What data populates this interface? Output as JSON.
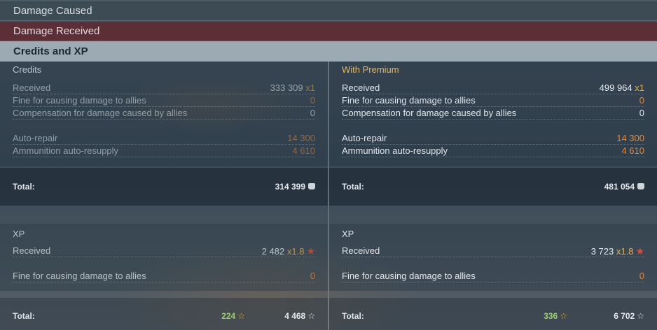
{
  "tabs": {
    "damage_caused": "Damage Caused",
    "damage_received": "Damage Received",
    "credits_xp": "Credits and XP"
  },
  "credits": {
    "left": {
      "title": "Credits",
      "received_label": "Received",
      "received_value": "333 309",
      "received_mult": "x1",
      "fine_label": "Fine for causing damage to allies",
      "fine_value": "0",
      "comp_label": "Compensation for damage caused by allies",
      "comp_value": "0",
      "repair_label": "Auto-repair",
      "repair_value": "14 300",
      "ammo_label": "Ammunition auto-resupply",
      "ammo_value": "4 610",
      "total_label": "Total:",
      "total_value": "314 399"
    },
    "right": {
      "title": "With Premium",
      "received_label": "Received",
      "received_value": "499 964",
      "received_mult": "x1",
      "fine_label": "Fine for causing damage to allies",
      "fine_value": "0",
      "comp_label": "Compensation for damage caused by allies",
      "comp_value": "0",
      "repair_label": "Auto-repair",
      "repair_value": "14 300",
      "ammo_label": "Ammunition auto-resupply",
      "ammo_value": "4 610",
      "total_label": "Total:",
      "total_value": "481 054"
    }
  },
  "xp": {
    "left": {
      "title": "XP",
      "received_label": "Received",
      "received_value": "2 482",
      "received_mult": "x1.8",
      "fine_label": "Fine for causing damage to allies",
      "fine_value": "0",
      "total_label": "Total:",
      "total_free": "224",
      "total_value": "4 468"
    },
    "right": {
      "title": "XP",
      "received_label": "Received",
      "received_value": "3 723",
      "received_mult": "x1.8",
      "fine_label": "Fine for causing damage to allies",
      "fine_value": "0",
      "total_label": "Total:",
      "total_free": "336",
      "total_value": "6 702"
    }
  },
  "icons": {
    "credits": "credits-coin-icon",
    "xp": "xp-star-icon",
    "free_xp": "free-xp-star-icon",
    "premium_multiplier": "premium-star-icon"
  },
  "colors": {
    "damage_received_bar": "#5c2f36",
    "credits_bar": "#9cabb3",
    "premium_title": "#e7b85c",
    "expense": "#e2883a",
    "multiplier": "#e2b04a",
    "free_xp": "#9bd06a"
  }
}
